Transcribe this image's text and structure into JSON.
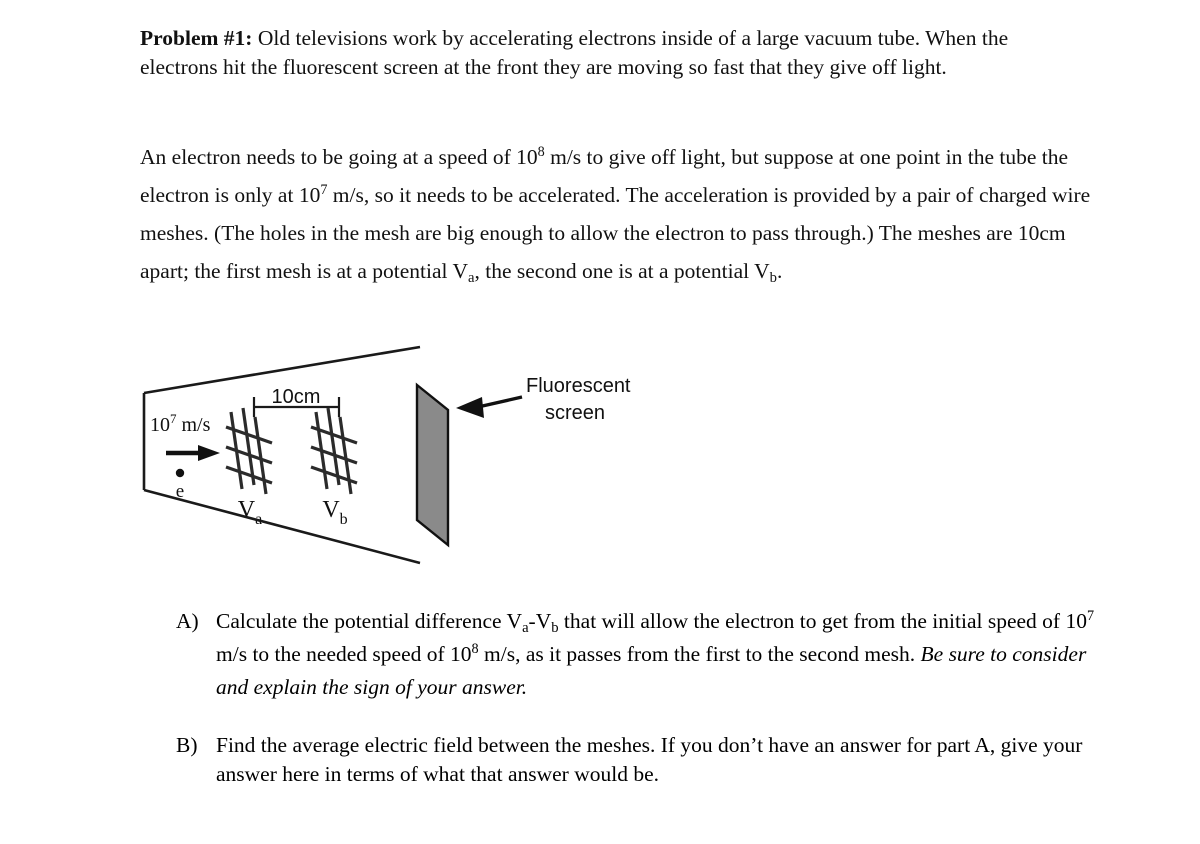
{
  "document": {
    "problem_label": "Problem #1:",
    "intro": " Old televisions work by accelerating electrons inside of a large vacuum tube.  When the electrons hit the fluorescent screen at the front they are moving so fast that they give off light.",
    "setup": {
      "s1": "An electron needs to be going at a speed of 10",
      "exp1": "8",
      "s2": " m/s to give off light, but suppose at one point in the tube the electron is only at 10",
      "exp2": "7",
      "s3": " m/s, so it needs to be accelerated.  The acceleration is provided by a pair of charged wire meshes.  (The holes in the mesh are big enough to allow the electron to pass through.)  The meshes are 10cm apart; the first mesh is at a potential V",
      "sub1": "a",
      "s4": ", the second one is at a potential V",
      "sub2": "b",
      "s5": "."
    }
  },
  "questions": [
    {
      "marker": "A)",
      "s1": "Calculate the potential difference V",
      "sub1": "a",
      "s2": "-V",
      "sub2": "b",
      "s3": " that will allow the electron to get from the initial speed of 10",
      "exp1": "7",
      "s4": " m/s to the needed speed of 10",
      "exp2": "8",
      "s5": " m/s, as it passes from the first to the second mesh. ",
      "emphasis": "Be sure to consider and explain the sign of your answer."
    },
    {
      "marker": "B)",
      "s1": "Find the average electric field between the meshes.  If you don’t have an answer for part A, give your answer here in terms of what that answer would be.",
      "sub1": "",
      "s2": "",
      "sub2": "",
      "s3": "",
      "exp1": "",
      "s4": "",
      "exp2": "",
      "s5": "",
      "emphasis": ""
    }
  ],
  "figure": {
    "speed_label": "10",
    "speed_exponent": "7",
    "speed_units": " m/s",
    "electron_label": "e",
    "distance_label": "10cm",
    "mesh_a_label": "V",
    "mesh_a_subscript": "a",
    "mesh_b_label": "V",
    "mesh_b_subscript": "b",
    "screen_label_line1": "Fluorescent",
    "screen_label_line2": "screen",
    "screen_fill_color": "#8a8a8a",
    "line_color": "#1a1a1a"
  }
}
